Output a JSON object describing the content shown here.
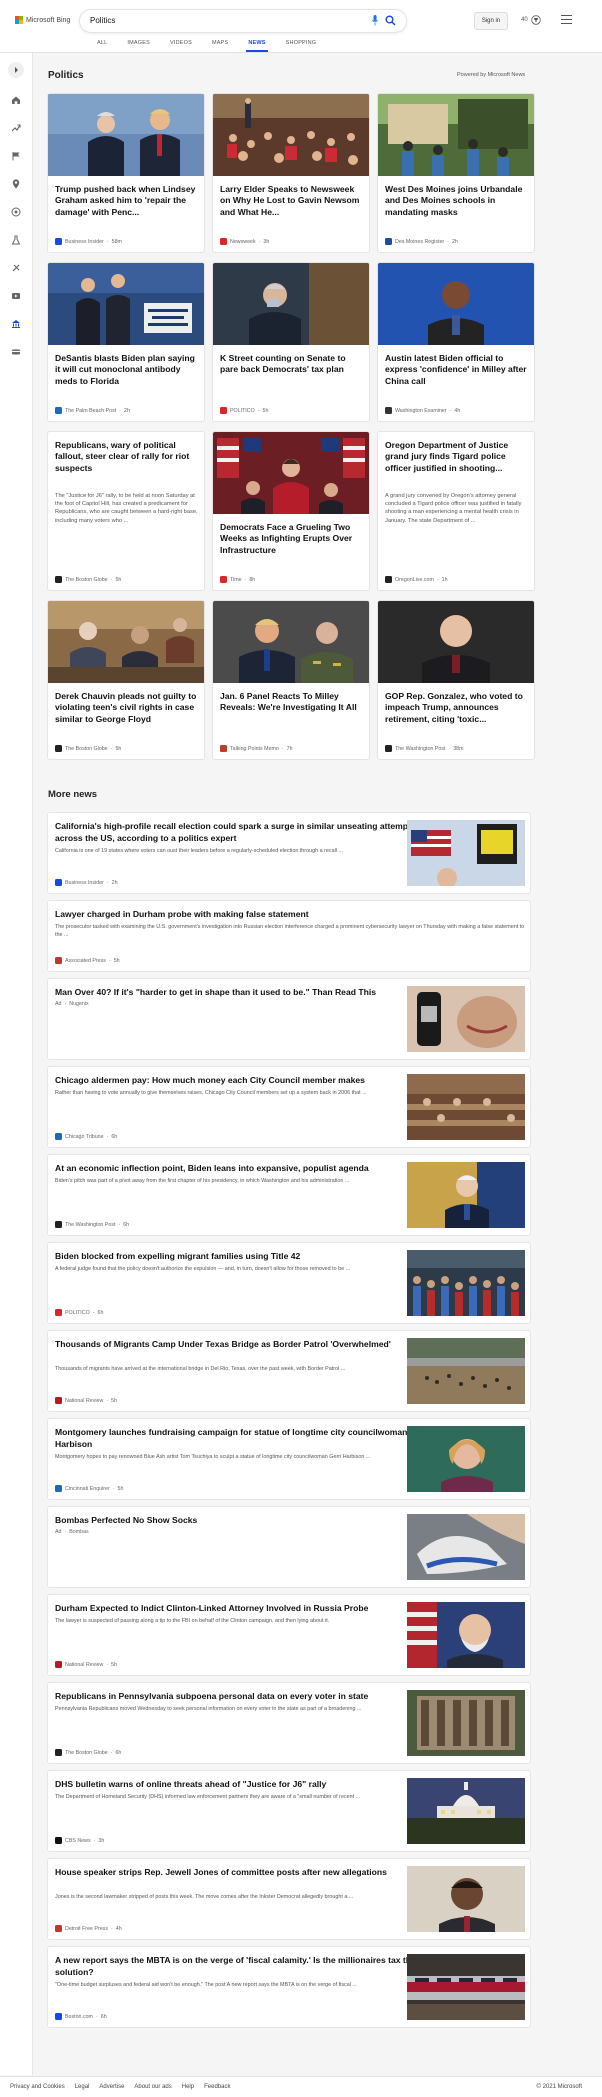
{
  "header": {
    "brand": "Microsoft Bing",
    "query": "Politics",
    "signin": "Sign in",
    "rewards_points": "40",
    "tabs": [
      "ALL",
      "IMAGES",
      "VIDEOS",
      "MAPS",
      "NEWS",
      "SHOPPING"
    ],
    "active_tab": "NEWS"
  },
  "section": {
    "title": "Politics",
    "powered": "Powered by Microsoft News"
  },
  "cards": [
    {
      "headline": "Trump pushed back when Lindsey Graham asked him to 'repair the damage' with Penc...",
      "source": "Business Insider",
      "time": "58m",
      "color": "#174ae4"
    },
    {
      "headline": "Larry Elder Speaks to Newsweek on Why He Lost to Gavin Newsom and What He...",
      "source": "Newsweek",
      "time": "3h",
      "color": "#e0252a"
    },
    {
      "headline": "West Des Moines joins Urbandale and Des Moines schools in mandating masks",
      "source": "Des Moines Register",
      "time": "2h",
      "color": "#1b4f9c"
    },
    {
      "headline": "DeSantis blasts Biden plan saying it will cut monoclonal antibody meds to Florida",
      "source": "The Palm Beach Post",
      "time": "2h",
      "color": "#1d6bb8"
    },
    {
      "headline": "K Street counting on Senate to pare back Democrats' tax plan",
      "source": "POLITICO",
      "time": "5h",
      "color": "#d62828"
    },
    {
      "headline": "Austin latest Biden official to express 'confidence' in Milley after China call",
      "source": "Washington Examiner",
      "time": "4h",
      "color": "#333333"
    },
    {
      "headline": "Republicans, wary of political fallout, steer clear of rally for riot suspects",
      "abstract": "The \"Justice for J6\" rally, to be held at noon Saturday at the foot of Capitol Hill, has created a predicament for Republicans, who are caught between a hard-right base, including many voters who ...",
      "source": "The Boston Globe",
      "time": "5h",
      "color": "#222222"
    },
    {
      "headline": "Democrats Face a Grueling Two Weeks as Infighting Erupts Over Infrastructure",
      "source": "Time",
      "time": "8h",
      "color": "#e0252a"
    },
    {
      "headline": "Oregon Department of Justice grand jury finds Tigard police officer justified in shooting...",
      "abstract": "A grand jury convened by Oregon's attorney general concluded a Tigard police officer was justified in fatally shooting a man experiencing a mental health crisis in January. The state Department of ...",
      "source": "OregonLive.com",
      "time": "1h",
      "color": "#222222"
    },
    {
      "headline": "Derek Chauvin pleads not guilty to violating teen's civil rights in case similar to George Floyd",
      "source": "The Boston Globe",
      "time": "5h",
      "color": "#222222"
    },
    {
      "headline": "Jan. 6 Panel Reacts To Milley Reveals: We're Investigating It All",
      "source": "Talking Points Memo",
      "time": "7h",
      "color": "#c0392b"
    },
    {
      "headline": "GOP Rep. Gonzalez, who voted to impeach Trump, announces retirement, citing 'toxic...",
      "source": "The Washington Post",
      "time": "38m",
      "color": "#222222"
    }
  ],
  "more_news_title": "More news",
  "more_news": [
    {
      "title": "California's high-profile recall election could spark a surge in similar unseating attempts across the US, according to a politics expert",
      "desc": "California is one of 19 states where voters can oust their leaders before a regularly-scheduled election through a recall ...",
      "source": "Business Insider",
      "time": "2h",
      "color": "#174ae4"
    },
    {
      "title": "Lawyer charged in Durham probe with making false statement",
      "desc": "The prosecutor tasked with examining the U.S. government's investigation into Russian election interference charged a prominent cybersecurity lawyer on Thursday with making a false statement to the ...",
      "source": "Associated Press",
      "time": "5h",
      "color": "#c0392b"
    },
    {
      "title": "Man Over 40? If it's \"harder to get in shape than it used to be.\" Than Read This",
      "desc": "",
      "source": "Nugenix",
      "time": "Ad",
      "color": "#999999"
    },
    {
      "title": "Chicago aldermen pay: How much money each City Council member makes",
      "desc": "Rather than having to vote annually to give themselves raises, Chicago City Council members set up a system back in 2006 that ...",
      "source": "Chicago Tribune",
      "time": "6h",
      "color": "#1d6bb8"
    },
    {
      "title": "At an economic inflection point, Biden leans into expansive, populist agenda",
      "desc": "Biden's pitch was part of a pivot away from the first chapter of his presidency, in which Washington and his administration ...",
      "source": "The Washington Post",
      "time": "6h",
      "color": "#222222"
    },
    {
      "title": "Biden blocked from expelling migrant families using Title 42",
      "desc": "A federal judge found that the policy doesn't authorize the expulsion — and, in turn, doesn't allow for those removed to be ...",
      "source": "POLITICO",
      "time": "6h",
      "color": "#d62828"
    },
    {
      "title": "Thousands of Migrants Camp Under Texas Bridge as Border Patrol 'Overwhelmed'",
      "desc": "Thousands of migrants have arrived at the international bridge in Del Rio, Texas, over the past week, with Border Patrol ...",
      "source": "National Review",
      "time": "5h",
      "color": "#b71c1c"
    },
    {
      "title": "Montgomery launches fundraising campaign for statue of longtime city councilwoman Gerri Harbison",
      "desc": "Montgomery hopes to pay renowned Blue Ash artist Tom Tsuchiya to sculpt a statue of longtime city councilwoman Gerri Harbison ...",
      "source": "Cincinnati Enquirer",
      "time": "5h",
      "color": "#1d6bb8"
    },
    {
      "title": "Bombas Perfected No Show Socks",
      "desc": "",
      "source": "Bombas",
      "time": "Ad",
      "color": "#999999"
    },
    {
      "title": "Durham Expected to Indict Clinton-Linked Attorney Involved in Russia Probe",
      "desc": "The lawyer is suspected of passing along a tip to the FBI on behalf of the Clinton campaign, and then lying about it.",
      "source": "National Review",
      "time": "5h",
      "color": "#b71c1c"
    },
    {
      "title": "Republicans in Pennsylvania subpoena personal data on every voter in state",
      "desc": "Pennsylvania Republicans moved Wednesday to seek personal information on every voter in the state as part of a broadening ...",
      "source": "The Boston Globe",
      "time": "6h",
      "color": "#222222"
    },
    {
      "title": "DHS bulletin warns of online threats ahead of \"Justice for J6\" rally",
      "desc": "The Department of Homeland Security (DHS) informed law enforcement partners they are aware of a \"small number of recent ...",
      "source": "CBS News",
      "time": "3h",
      "color": "#111111"
    },
    {
      "title": "House speaker strips Rep. Jewell Jones of committee posts after new allegations",
      "desc": "Jones is the second lawmaker stripped of posts this week. The move comes after the Inkster Democrat allegedly brought a ...",
      "source": "Detroit Free Press",
      "time": "4h",
      "color": "#c0392b"
    },
    {
      "title": "A new report says the MBTA is on the verge of 'fiscal calamity.' Is the millionaires tax the solution?",
      "desc": "\"One-time budget surpluses and federal aid won't be enough.\" The post A new report says the MBTA is on the verge of fiscal ...",
      "source": "Boston.com",
      "time": "6h",
      "color": "#174ae4"
    }
  ],
  "footer": {
    "links": [
      "Privacy and Cookies",
      "Legal",
      "Advertise",
      "About our ads",
      "Help",
      "Feedback"
    ],
    "copyright": "© 2021 Microsoft"
  }
}
